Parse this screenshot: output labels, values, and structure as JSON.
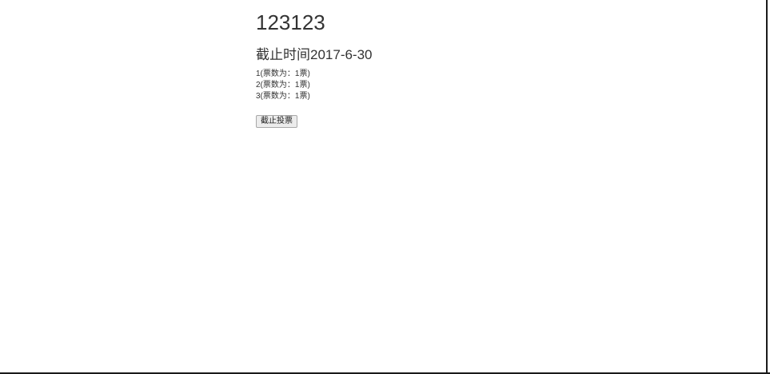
{
  "poll": {
    "title": "123123",
    "deadline": "截止时间2017-6-30",
    "options": [
      "1(票数为：1票)",
      "2(票数为：1票)",
      "3(票数为：1票)"
    ],
    "end_button_label": "截止投票"
  }
}
